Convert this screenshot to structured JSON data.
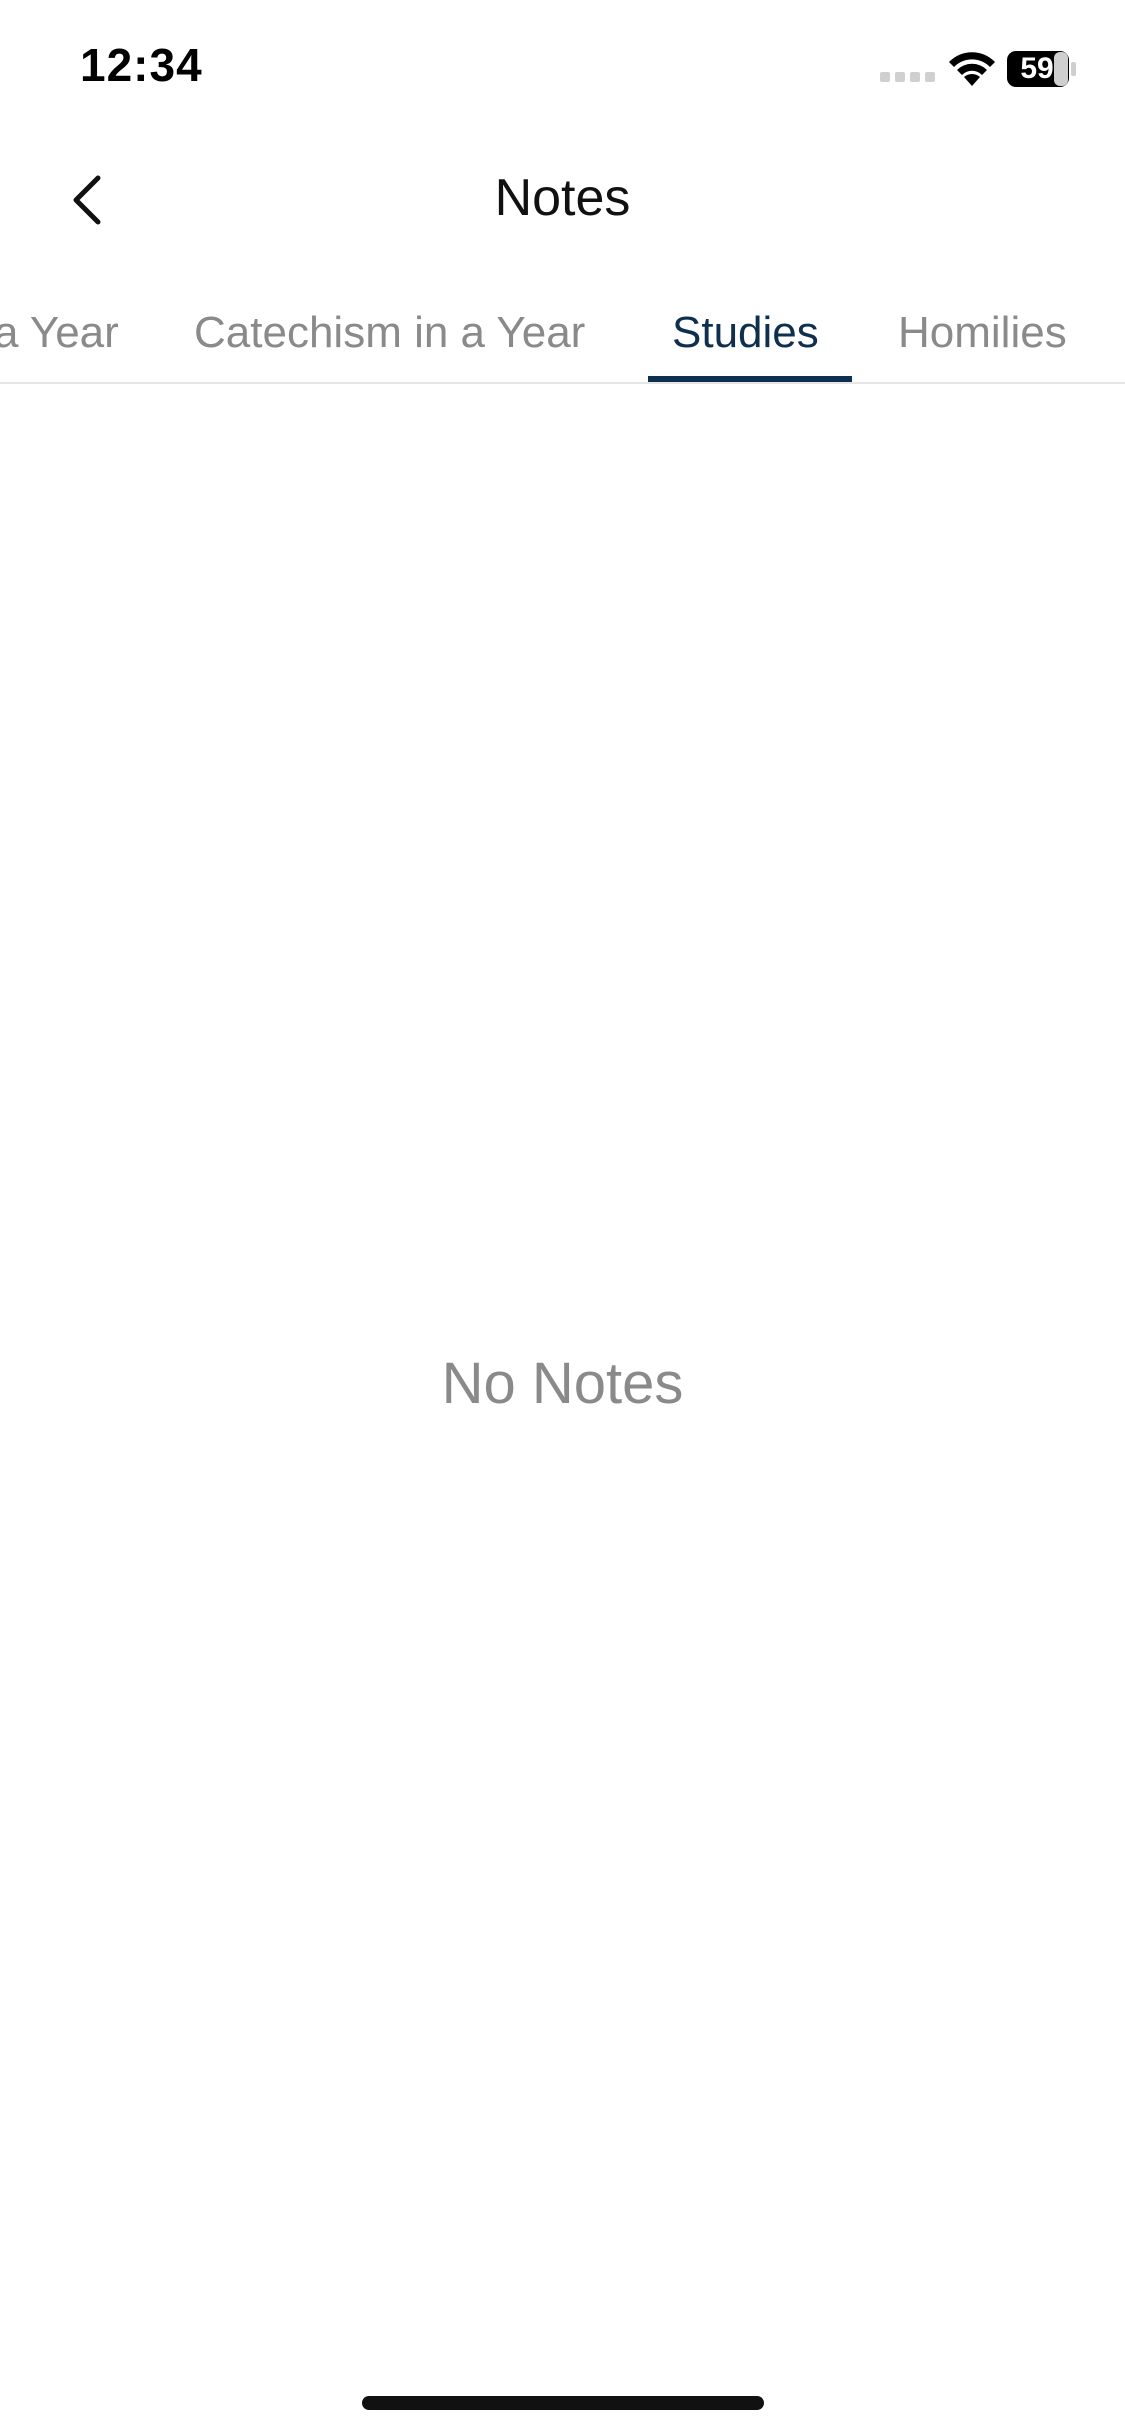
{
  "status_bar": {
    "time": "12:34",
    "battery_level": "59",
    "icons": [
      "signal-icon",
      "wifi-icon",
      "battery-icon"
    ]
  },
  "nav": {
    "back_icon": "chevron-left-icon",
    "title": "Notes"
  },
  "tabs": [
    {
      "label": "a Year",
      "active": false
    },
    {
      "label": "Catechism in a Year",
      "active": false
    },
    {
      "label": "Studies",
      "active": true
    },
    {
      "label": "Homilies",
      "active": false
    }
  ],
  "content": {
    "empty_message": "No Notes"
  },
  "colors": {
    "accent": "#0f2f4f",
    "inactive_text": "#8a8a8a",
    "divider": "#e5e5e5"
  }
}
